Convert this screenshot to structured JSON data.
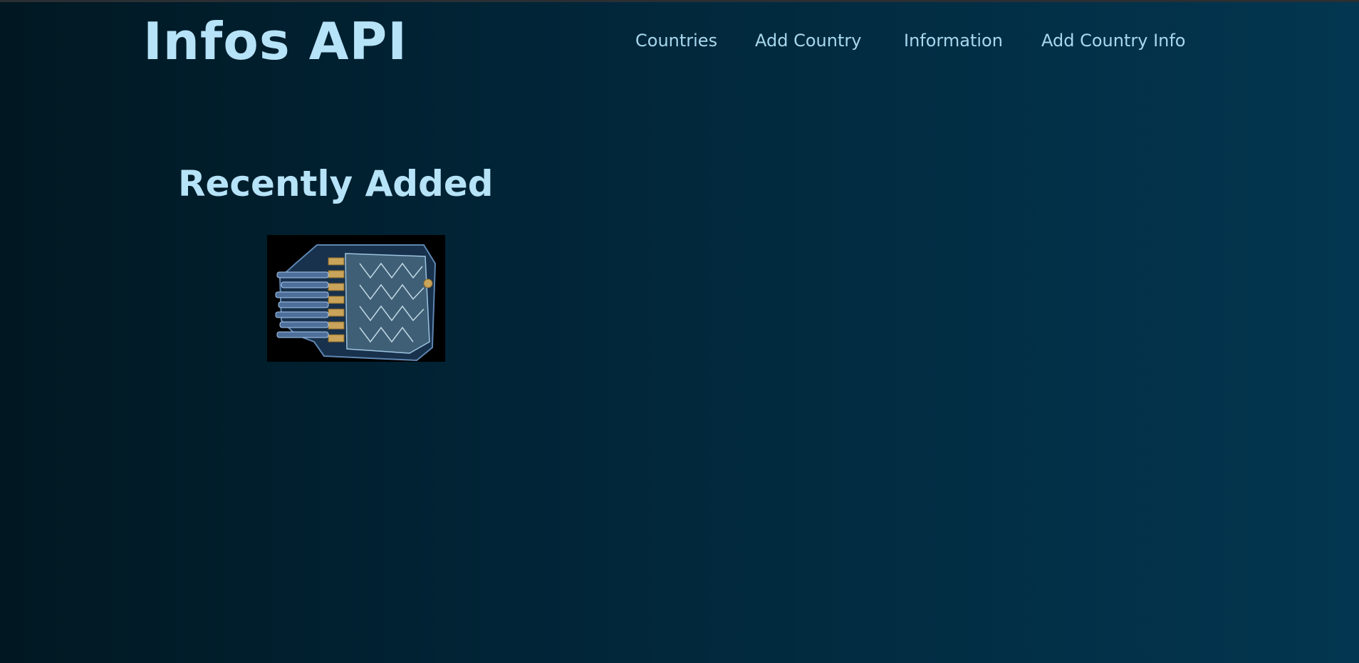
{
  "header": {
    "brand": "Infos API",
    "nav": [
      {
        "label": "Countries"
      },
      {
        "label": "Add Country"
      },
      {
        "label": "Information"
      },
      {
        "label": "Add Country Info"
      }
    ]
  },
  "main": {
    "section_title": "Recently Added",
    "items": [
      {
        "image": "rj45-connector-image"
      }
    ]
  },
  "colors": {
    "accent_text": "#b6e3f8",
    "nav_text": "#a8d8ee",
    "background_dark": "#011822",
    "background_light": "#033650"
  }
}
